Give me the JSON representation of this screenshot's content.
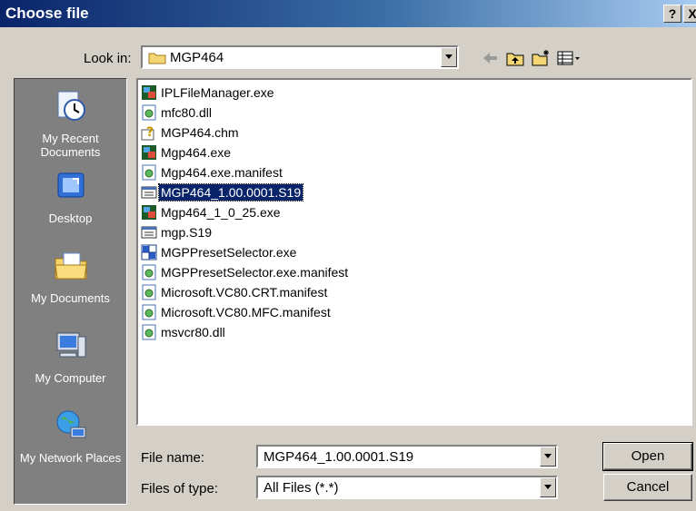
{
  "title": "Choose file",
  "title_buttons": {
    "help": "?",
    "close": "X"
  },
  "look_in": {
    "label": "Look in:",
    "value": "MGP464"
  },
  "places": [
    {
      "label": "My Recent Documents",
      "icon": "recent-documents-icon"
    },
    {
      "label": "Desktop",
      "icon": "desktop-icon"
    },
    {
      "label": "My Documents",
      "icon": "my-documents-icon"
    },
    {
      "label": "My Computer",
      "icon": "my-computer-icon"
    },
    {
      "label": "My Network Places",
      "icon": "network-places-icon"
    }
  ],
  "files": [
    {
      "name": "IPLFileManager.exe",
      "icon": "exe-app-icon"
    },
    {
      "name": "mfc80.dll",
      "icon": "dll-icon"
    },
    {
      "name": "MGP464.chm",
      "icon": "help-file-icon"
    },
    {
      "name": "Mgp464.exe",
      "icon": "exe-app-icon"
    },
    {
      "name": "Mgp464.exe.manifest",
      "icon": "dll-icon"
    },
    {
      "name": "MGP464_1.00.0001.S19",
      "icon": "s19-file-icon",
      "selected": true
    },
    {
      "name": "Mgp464_1_0_25.exe",
      "icon": "exe-app-icon"
    },
    {
      "name": "mgp.S19",
      "icon": "s19-file-icon"
    },
    {
      "name": "MGPPresetSelector.exe",
      "icon": "exe-grid-icon"
    },
    {
      "name": "MGPPresetSelector.exe.manifest",
      "icon": "dll-icon"
    },
    {
      "name": "Microsoft.VC80.CRT.manifest",
      "icon": "dll-icon"
    },
    {
      "name": "Microsoft.VC80.MFC.manifest",
      "icon": "dll-icon"
    },
    {
      "name": "msvcr80.dll",
      "icon": "dll-icon"
    }
  ],
  "file_name": {
    "label": "File name:",
    "value": "MGP464_1.00.0001.S19"
  },
  "file_type": {
    "label": "Files of type:",
    "value": "All Files (*.*)"
  },
  "buttons": {
    "open": "Open",
    "cancel": "Cancel"
  },
  "colors": {
    "title_bar": "#0a246a",
    "selection": "#0a246a",
    "places_bar": "#808080",
    "dialog_face": "#d4d0c8"
  }
}
